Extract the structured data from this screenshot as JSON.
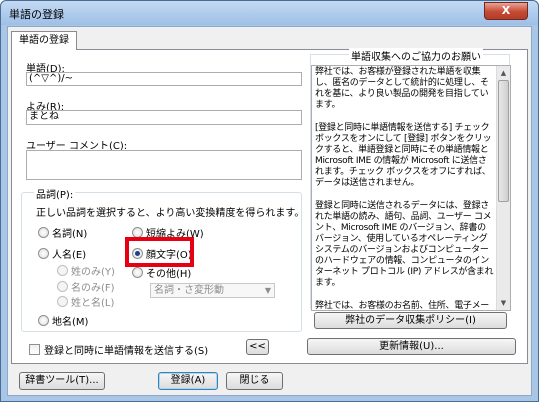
{
  "window": {
    "title": "単語の登録",
    "close_glyph": "X"
  },
  "tab": {
    "label": "単語の登録"
  },
  "fields": {
    "word": {
      "label": "単語(D):",
      "value": "(^▽^)/~"
    },
    "reading": {
      "label": "よみ(R):",
      "value": "まとね"
    },
    "comment": {
      "label": "ユーザー コメント(C):",
      "value": ""
    }
  },
  "pos": {
    "label": "品詞(P):",
    "description": "正しい品詞を選択すると、より高い変換精度を得られます。",
    "options": {
      "noun": "名詞(N)",
      "person": "人名(E)",
      "surname": "姓のみ(Y)",
      "given": "名のみ(F)",
      "fullname": "姓と名(L)",
      "place": "地名(M)",
      "short": "短縮よみ(W)",
      "emoticon": "顔文字(O)",
      "other": "その他(H)"
    },
    "selected": "emoticon",
    "other_select_value": "名詞・さ変形動"
  },
  "send_checkbox": {
    "label": "登録と同時に単語情報を送信する(S)",
    "checked": false
  },
  "collapse_button": {
    "label": "<<"
  },
  "info": {
    "title": "単語収集へのご協力のお願い",
    "paragraphs": [
      "弊社では、お客様が登録された単語を収集し、匿名のデータとして統計的に処理し、それを基に、より良い製品の開発を目指しています。",
      "[登録と同時に単語情報を送信する] チェック ボックスをオンにして [登録] ボタンをクリックすると、単語登録と同時にその単語情報と Microsoft IME の情報が Microsoft に送信されます。チェック ボックスをオフにすれば、データは送信されません。",
      "登録と同時に送信されるデータには、登録された単語の読み、語句、品詞、ユーザー コメント、Microsoft IME のバージョン、辞書のバージョン、使用しているオペレーティング システムのバージョンおよびコンピューターのハードウェアの情報、コンピュータのインターネット プロトコル (IP) アドレスが含まれます。",
      "弊社では、お客様のお名前、住所、電子メール アドレスなど個人を特定できるいかなる形態の情報も意図的に収集することはあり"
    ],
    "policy_button": "弊社のデータ収集ポリシー(I)"
  },
  "buttons": {
    "update": "更新情報(U)...",
    "dictionary_tool": "辞書ツール(T)...",
    "register": "登録(A)",
    "close": "閉じる"
  },
  "colors": {
    "highlight_border": "#e60012",
    "title_gradient": "#9ebfe6",
    "close_button": "#c44a33"
  }
}
